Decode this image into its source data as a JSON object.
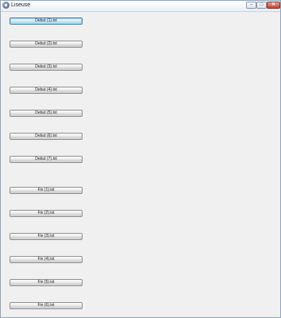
{
  "window": {
    "title": "Liseuse"
  },
  "controls": {
    "minimize": "–",
    "maximize": "□",
    "close": "✕"
  },
  "buttons": {
    "debut": [
      "Debut (1).txt",
      "Debut (2).txt",
      "Debut (3).txt",
      "Debut (4).txt",
      "Debut (5).txt",
      "Debut (6).txt",
      "Debut (7).txt"
    ],
    "fin": [
      "Fin (1).txt",
      "Fin (2).txt",
      "Fin (3).txt",
      "Fin (4).txt",
      "Fin (5).txt",
      "Fin (6).txt"
    ]
  }
}
